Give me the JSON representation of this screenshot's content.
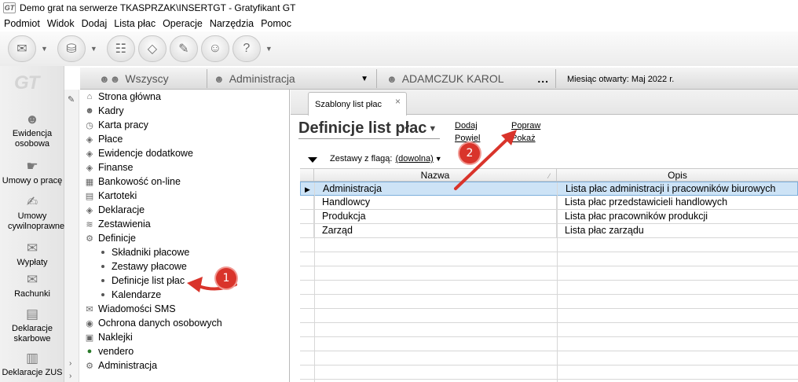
{
  "window": {
    "title": "Demo grat na serwerze TKASPRZAK\\INSERTGT - Gratyfikant GT",
    "app_icon_text": "GT"
  },
  "menu": [
    "Podmiot",
    "Widok",
    "Dodaj",
    "Lista płac",
    "Operacje",
    "Narzędzia",
    "Pomoc"
  ],
  "toolbar": {
    "icons": [
      "envelope-icon",
      "inbox-icon",
      "payroll-icon",
      "eraser-icon",
      "tools-icon",
      "users-icon",
      "help-icon"
    ]
  },
  "leftnav": {
    "logo": "GT",
    "items": [
      {
        "label": "Ewidencja osobowa",
        "icon": "people-icon"
      },
      {
        "label": "Umowy o pracę",
        "icon": "handshake-icon"
      },
      {
        "label": "Umowy cywilnoprawne",
        "icon": "contract-icon"
      },
      {
        "label": "Wypłaty",
        "icon": "wallet-icon"
      },
      {
        "label": "Rachunki",
        "icon": "receipt-icon"
      },
      {
        "label": "Deklaracje skarbowe",
        "icon": "tax-icon"
      },
      {
        "label": "Deklaracje ZUS",
        "icon": "zus-icon"
      }
    ]
  },
  "filterbar": {
    "group": "Wszyscy",
    "department": "Administracja",
    "employee": "ADAMCZUK KAROL",
    "dots": "...",
    "month_label": "Miesiąc otwarty:  Maj 2022 r."
  },
  "tree": {
    "items": [
      {
        "label": "Strona główna",
        "icon": "home-icon"
      },
      {
        "label": "Kadry",
        "icon": "people-icon"
      },
      {
        "label": "Karta pracy",
        "icon": "clock-icon"
      },
      {
        "label": "Płace",
        "icon": "money-icon"
      },
      {
        "label": "Ewidencje dodatkowe",
        "icon": "folder-icon"
      },
      {
        "label": "Finanse",
        "icon": "coins-icon"
      },
      {
        "label": "Bankowość on-line",
        "icon": "bank-icon"
      },
      {
        "label": "Kartoteki",
        "icon": "card-icon"
      },
      {
        "label": "Deklaracje",
        "icon": "document-icon"
      },
      {
        "label": "Zestawienia",
        "icon": "chart-icon"
      },
      {
        "label": "Definicje",
        "icon": "gear-icon"
      }
    ],
    "sub_items": [
      "Składniki płacowe",
      "Zestawy płacowe",
      "Definicje list płac",
      "Kalendarze"
    ],
    "items_after": [
      {
        "label": "Wiadomości SMS",
        "icon": "sms-icon"
      },
      {
        "label": "Ochrona danych osobowych",
        "icon": "shield-icon"
      },
      {
        "label": "Naklejki",
        "icon": "sticker-icon"
      },
      {
        "label": "vendero",
        "icon": "vendero-icon"
      },
      {
        "label": "Administracja",
        "icon": "admin-icon"
      }
    ]
  },
  "annotations": {
    "badge1": "1",
    "badge2": "2",
    "color": "#d9342b"
  },
  "main": {
    "tab_label": "Szablony list płac",
    "tab_close": "×",
    "page_title": "Definicje list płac",
    "actions": {
      "dodaj": "Dodaj",
      "powiel": "Powiel",
      "popraw": "Popraw",
      "pokaz": "Pokaż"
    },
    "filter_label": "Zestawy z flagą:",
    "filter_value": "(dowolna)",
    "grid": {
      "columns": [
        "Nazwa",
        "Opis"
      ],
      "rows": [
        {
          "nazwa": "Administracja",
          "opis": "Lista płac administracji i pracowników biurowych"
        },
        {
          "nazwa": "Handlowcy",
          "opis": "Lista płac przedstawicieli handlowych"
        },
        {
          "nazwa": "Produkcja",
          "opis": "Lista płac pracowników produkcji"
        },
        {
          "nazwa": "Zarząd",
          "opis": "Lista płac zarządu"
        }
      ]
    }
  }
}
